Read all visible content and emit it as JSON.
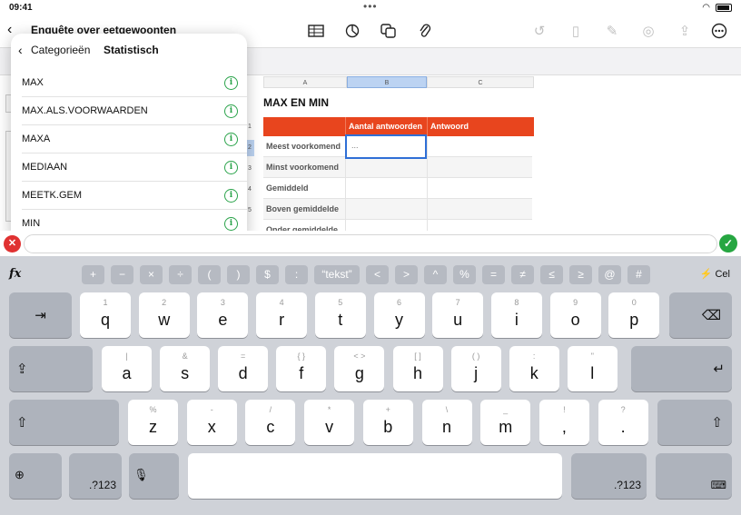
{
  "status": {
    "time": "09:41",
    "dots": "•••"
  },
  "toolbar": {
    "back": "‹",
    "title": "Enquête over eetgewoonten",
    "chevron": "⌄"
  },
  "sheet": {
    "columns": [
      "A",
      "B",
      "C"
    ],
    "table_title": "MAX EN MIN",
    "headers": [
      "",
      "Aantal antwoorden",
      "Antwoord"
    ],
    "rows": [
      "Meest voorkomend",
      "Minst voorkomend",
      "Gemiddeld",
      "Boven gemiddelde",
      "Onder gemiddelde"
    ],
    "selected_cell_text": "...",
    "row_numbers": [
      "1",
      "2",
      "3",
      "4",
      "5"
    ]
  },
  "popover": {
    "back_label": "Categorieën",
    "title": "Statistisch",
    "items": [
      "MAX",
      "MAX.ALS.VOORWAARDEN",
      "MAXA",
      "MEDIAAN",
      "MEETK.GEM",
      "MIN"
    ]
  },
  "keyboard": {
    "fx": "fx",
    "cel_label": "Cel",
    "symbols": [
      "+",
      "−",
      "×",
      "÷",
      "(",
      ")",
      "$",
      ":",
      "“tekst”",
      "<",
      ">",
      "^",
      "%",
      "=",
      "≠",
      "≤",
      "≥",
      "@",
      "#"
    ],
    "row1": [
      {
        "top": "1",
        "main": "q"
      },
      {
        "top": "2",
        "main": "w"
      },
      {
        "top": "3",
        "main": "e"
      },
      {
        "top": "4",
        "main": "r"
      },
      {
        "top": "5",
        "main": "t"
      },
      {
        "top": "6",
        "main": "y"
      },
      {
        "top": "7",
        "main": "u"
      },
      {
        "top": "8",
        "main": "i"
      },
      {
        "top": "9",
        "main": "o"
      },
      {
        "top": "0",
        "main": "p"
      }
    ],
    "row2": [
      {
        "top": "|",
        "main": "a"
      },
      {
        "top": "&",
        "main": "s"
      },
      {
        "top": "=",
        "main": "d"
      },
      {
        "top": "{  }",
        "main": "f"
      },
      {
        "top": "<  >",
        "main": "g"
      },
      {
        "top": "[  ]",
        "main": "h"
      },
      {
        "top": "(  )",
        "main": "j"
      },
      {
        "top": ":",
        "main": "k"
      },
      {
        "top": "\"",
        "main": "l"
      }
    ],
    "row3": [
      {
        "top": "%",
        "main": "z"
      },
      {
        "top": "-",
        "main": "x"
      },
      {
        "top": "/",
        "main": "c"
      },
      {
        "top": "*",
        "main": "v"
      },
      {
        "top": "+",
        "main": "b"
      },
      {
        "top": "\\",
        "main": "n"
      },
      {
        "top": "_",
        "main": "m"
      },
      {
        "top": "!",
        "main": ","
      },
      {
        "top": "?",
        "main": "."
      }
    ],
    "num_label": ".?123"
  }
}
